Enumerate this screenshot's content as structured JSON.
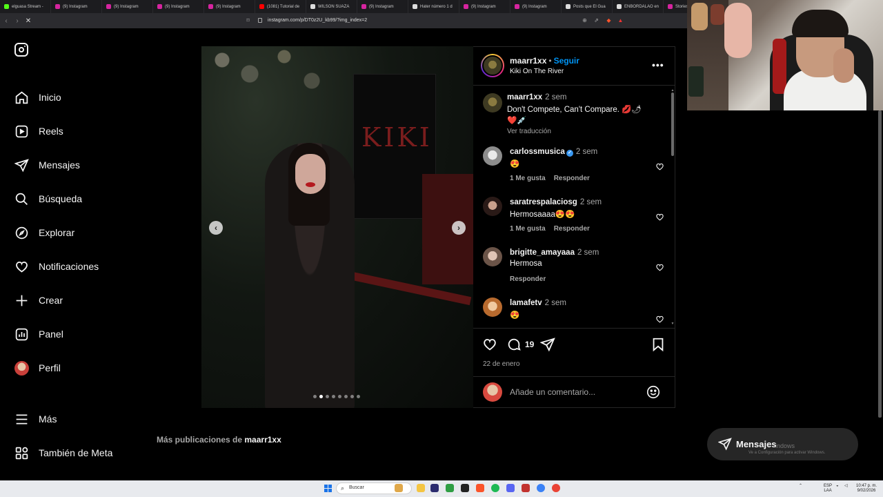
{
  "browser": {
    "tabs": [
      {
        "label": "elguasa Stream - ",
        "color": "#53fc18"
      },
      {
        "label": "(9) Instagram",
        "color": "#d6249f"
      },
      {
        "label": "(9) Instagram",
        "color": "#d6249f"
      },
      {
        "label": "(9) Instagram",
        "color": "#d6249f"
      },
      {
        "label": "(9) Instagram",
        "color": "#d6249f"
      },
      {
        "label": "(1081) Tutorial de",
        "color": "#ff0000"
      },
      {
        "label": "WILSON SUAZA",
        "color": "#dddddd"
      },
      {
        "label": "(9) Instagram",
        "color": "#d6249f"
      },
      {
        "label": "Hater número 1 d",
        "color": "#dddddd"
      },
      {
        "label": "(9) Instagram",
        "color": "#d6249f"
      },
      {
        "label": "(9) Instagram",
        "color": "#d6249f"
      },
      {
        "label": "Posts que El Gua",
        "color": "#dddddd"
      },
      {
        "label": "ENBORDALAO en",
        "color": "#dddddd"
      },
      {
        "label": "Stories",
        "color": "#d6249f"
      }
    ],
    "url": "instagram.com/p/DT0z2U_kb99/?img_index=2"
  },
  "sidebar": {
    "logo_icon": "instagram-logo-icon",
    "items": [
      {
        "label": "Inicio",
        "icon": "home-icon"
      },
      {
        "label": "Reels",
        "icon": "reels-icon"
      },
      {
        "label": "Mensajes",
        "icon": "messages-icon"
      },
      {
        "label": "Búsqueda",
        "icon": "search-icon"
      },
      {
        "label": "Explorar",
        "icon": "explore-icon"
      },
      {
        "label": "Notificaciones",
        "icon": "heart-icon"
      },
      {
        "label": "Crear",
        "icon": "plus-icon"
      },
      {
        "label": "Panel",
        "icon": "chart-icon"
      },
      {
        "label": "Perfil",
        "icon": "avatar"
      }
    ],
    "more_label": "Más",
    "meta_label": "También de Meta"
  },
  "post": {
    "sign_text": "KIKI",
    "carousel_prev": "‹",
    "carousel_next": "›",
    "image_count": 8,
    "current_image_index": 2,
    "header": {
      "username": "maarr1xx",
      "dot": "•",
      "follow_label": "Seguir",
      "location": "Kiki On The River",
      "more": "•••"
    },
    "caption": {
      "username": "maarr1xx",
      "time": "2 sem",
      "text": "Don't Compete, Can't Compare. 💋🌶",
      "text2": "❤️💉",
      "translate": "Ver traducción"
    },
    "comments": [
      {
        "username": "carlossmusica",
        "verified": true,
        "time": "2 sem",
        "text": "😍",
        "likes": "1 Me gusta",
        "reply": "Responder"
      },
      {
        "username": "saratrespalaciosg",
        "verified": false,
        "time": "2 sem",
        "text": "Hermosaaaa😍😍",
        "likes": "1 Me gusta",
        "reply": "Responder"
      },
      {
        "username": "brigitte_amayaaa",
        "verified": false,
        "time": "2 sem",
        "text": "Hermosa",
        "likes": "",
        "reply": "Responder"
      },
      {
        "username": "lamafetv",
        "verified": false,
        "time": "2 sem",
        "text": "😍",
        "likes": "",
        "reply": ""
      }
    ],
    "comment_count": "19",
    "date": "22 de enero",
    "add_comment_placeholder": "Añade un comentario..."
  },
  "more_posts": {
    "prefix": "Más publicaciones de ",
    "username": "maarr1xx"
  },
  "messages_float": {
    "label": "Mensajes"
  },
  "windows_watermark": {
    "line1": "indows",
    "line2": "Ve a Configuración para activar Windows."
  },
  "taskbar": {
    "search_label": "Buscar",
    "lang": "ESP\nLAA",
    "time": "10:47 p. m.",
    "date": "9/02/2026"
  },
  "colors": {
    "accent": "#0095f6",
    "background": "#000000",
    "muted_text": "#a8a8a8"
  }
}
